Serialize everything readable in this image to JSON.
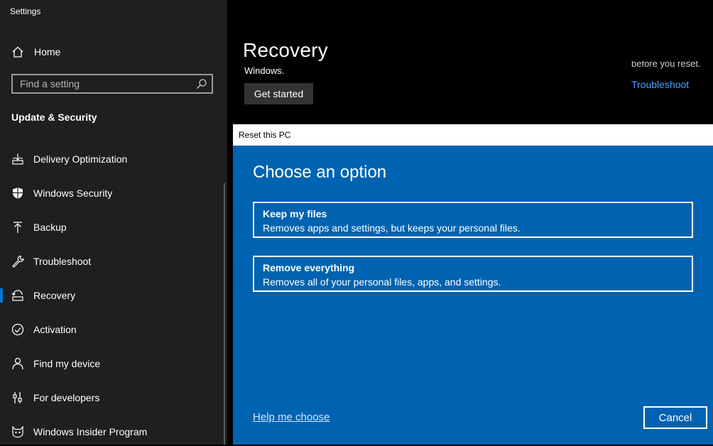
{
  "window": {
    "title": "Settings"
  },
  "sidebar": {
    "home_label": "Home",
    "search_placeholder": "Find a setting",
    "section_title": "Update & Security",
    "items": [
      {
        "label": "Delivery Optimization",
        "icon": "delivery-optimization-icon",
        "active": false
      },
      {
        "label": "Windows Security",
        "icon": "shield-icon",
        "active": false
      },
      {
        "label": "Backup",
        "icon": "backup-arrow-icon",
        "active": false
      },
      {
        "label": "Troubleshoot",
        "icon": "wrench-icon",
        "active": false
      },
      {
        "label": "Recovery",
        "icon": "recovery-icon",
        "active": true
      },
      {
        "label": "Activation",
        "icon": "checkmark-circle-icon",
        "active": false
      },
      {
        "label": "Find my device",
        "icon": "person-location-icon",
        "active": false
      },
      {
        "label": "For developers",
        "icon": "developer-tools-icon",
        "active": false
      },
      {
        "label": "Windows Insider Program",
        "icon": "insider-cat-icon",
        "active": false
      }
    ]
  },
  "main": {
    "title": "Recovery",
    "clipped_text_left": "Windows.",
    "get_started_label": "Get started",
    "clipped_text_right": "before you reset.",
    "troubleshoot_link": "Troubleshoot"
  },
  "dialog": {
    "title": "Reset this PC",
    "heading": "Choose an option",
    "options": [
      {
        "title": "Keep my files",
        "description": "Removes apps and settings, but keeps your personal files."
      },
      {
        "title": "Remove everything",
        "description": "Removes all of your personal files, apps, and settings."
      }
    ],
    "help_link": "Help me choose",
    "cancel_label": "Cancel"
  },
  "colors": {
    "sidebar_bg": "#1f1f1f",
    "main_bg": "#000000",
    "dialog_bg": "#0063b1",
    "accent": "#0078d7",
    "link": "#4ea3ff"
  }
}
